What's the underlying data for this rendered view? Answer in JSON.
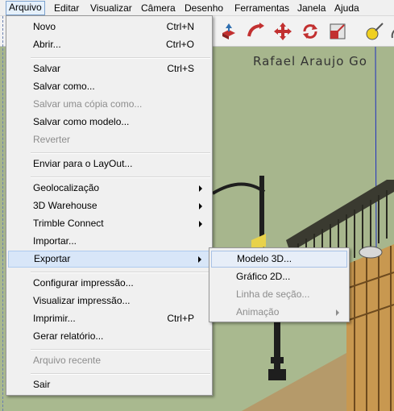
{
  "menubar": {
    "items": [
      "Arquivo",
      "Editar",
      "Visualizar",
      "Câmera",
      "Desenho",
      "Ferramentas",
      "Janela",
      "Ajuda"
    ],
    "active": "Arquivo"
  },
  "toolbar": {
    "icons": [
      "push-pull-icon",
      "follow-me-icon",
      "move-icon",
      "rotate-icon",
      "scale-icon",
      "tape-measure-icon",
      "protractor-icon"
    ]
  },
  "scene": {
    "title": "Rafael Araujo Go"
  },
  "file_menu": {
    "items": [
      {
        "label": "Novo",
        "shortcut": "Ctrl+N"
      },
      {
        "label": "Abrir...",
        "shortcut": "Ctrl+O"
      },
      {
        "label": "Salvar",
        "shortcut": "Ctrl+S"
      },
      {
        "label": "Salvar como...",
        "shortcut": ""
      },
      {
        "label": "Salvar uma cópia como...",
        "shortcut": "",
        "disabled": true
      },
      {
        "label": "Salvar como modelo...",
        "shortcut": ""
      },
      {
        "label": "Reverter",
        "shortcut": "",
        "disabled": true
      },
      {
        "label": "Enviar para o LayOut...",
        "shortcut": ""
      },
      {
        "label": "Geolocalização",
        "submenu": true
      },
      {
        "label": "3D Warehouse",
        "submenu": true
      },
      {
        "label": "Trimble Connect",
        "submenu": true
      },
      {
        "label": "Importar...",
        "shortcut": ""
      },
      {
        "label": "Exportar",
        "submenu": true,
        "highlighted": true
      },
      {
        "label": "Configurar impressão...",
        "shortcut": ""
      },
      {
        "label": "Visualizar impressão...",
        "shortcut": ""
      },
      {
        "label": "Imprimir...",
        "shortcut": "Ctrl+P"
      },
      {
        "label": "Gerar relatório...",
        "shortcut": ""
      },
      {
        "label": "Arquivo recente",
        "shortcut": "",
        "disabled": true
      },
      {
        "label": "Sair",
        "shortcut": ""
      }
    ]
  },
  "export_submenu": {
    "items": [
      {
        "label": "Modelo 3D...",
        "highlighted": true
      },
      {
        "label": "Gráfico 2D..."
      },
      {
        "label": "Linha de seção...",
        "disabled": true
      },
      {
        "label": "Animação",
        "disabled": true,
        "submenu": true
      }
    ]
  },
  "colors": {
    "menu_bg": "#f0f0f0",
    "highlight": "#d8e6f8",
    "disabled_text": "#8d8d8d",
    "scene_ground": "#a9b98f"
  }
}
